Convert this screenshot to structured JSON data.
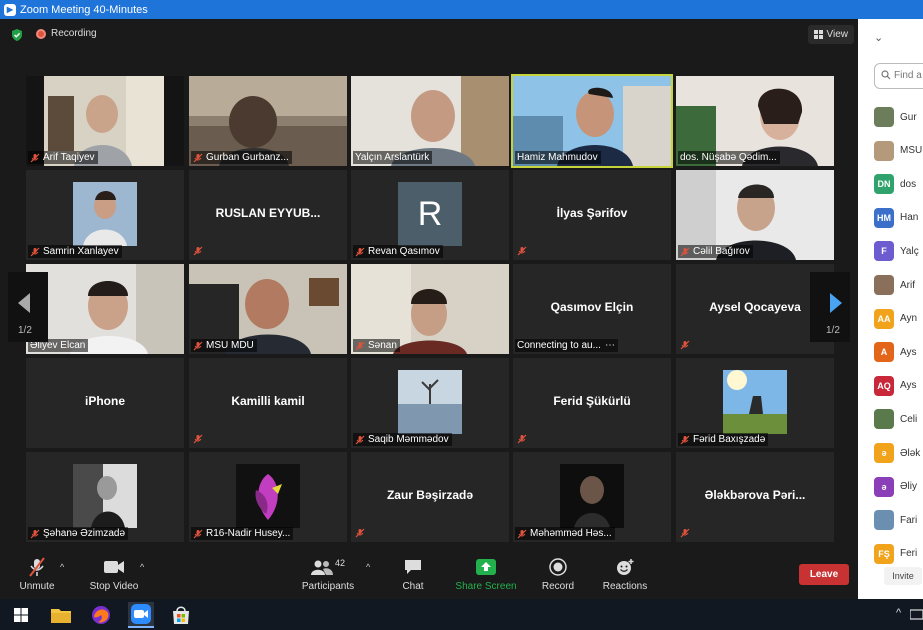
{
  "window": {
    "title": "Zoom Meeting 40-Minutes"
  },
  "topbar": {
    "recording_label": "Recording",
    "view_label": "View"
  },
  "tiles": [
    {
      "name": "Arif Taqiyev",
      "type": "video"
    },
    {
      "name": "Gurban Gurbanz...",
      "type": "video"
    },
    {
      "name": "Yalçın Arslantürk",
      "type": "video"
    },
    {
      "name": "Hamiz Mahmudov",
      "type": "video",
      "active": true
    },
    {
      "name": "dos. Nüşabə Qədim...",
      "type": "video"
    },
    {
      "name": "Samrin Xanlayev",
      "type": "picture"
    },
    {
      "name": "RUSLAN EYYUB...",
      "type": "name"
    },
    {
      "name": "Revan Qasımov",
      "type": "initial",
      "initial": "R"
    },
    {
      "name": "İlyas Şərifov",
      "type": "name"
    },
    {
      "name": "Cəlil Bağırov",
      "type": "video"
    },
    {
      "name": "Əliyev Elcan",
      "type": "video"
    },
    {
      "name": "MSU MDU",
      "type": "video"
    },
    {
      "name": "Sənan",
      "type": "video"
    },
    {
      "name": "Qasımov Elçin",
      "type": "name",
      "status": "Connecting to au..."
    },
    {
      "name": "Aysel Qocayeva",
      "type": "name"
    },
    {
      "name": "iPhone",
      "type": "name"
    },
    {
      "name": "Kamilli kamil",
      "type": "name"
    },
    {
      "name": "Saqib Məmmədov",
      "type": "picture"
    },
    {
      "name": "Ferid Şükürlü",
      "type": "name"
    },
    {
      "name": "Fərid Baxışzadə",
      "type": "picture"
    },
    {
      "name": "Şəhanə Əzimzadə",
      "type": "picture"
    },
    {
      "name": "R16-Nadir Husey...",
      "type": "picture"
    },
    {
      "name": "Zaur Bəşirzadə",
      "type": "name"
    },
    {
      "name": "Məhəmməd Həs...",
      "type": "picture"
    },
    {
      "name": "Ələkbərova Pəri...",
      "type": "name"
    }
  ],
  "paging": {
    "left": "1/2",
    "right": "1/2"
  },
  "toolbar": {
    "unmute": "Unmute",
    "stop_video": "Stop Video",
    "participants": "Participants",
    "participants_count": "42",
    "chat": "Chat",
    "share_screen": "Share Screen",
    "record": "Record",
    "reactions": "Reactions",
    "leave": "Leave"
  },
  "panel": {
    "find_placeholder": "Find a",
    "invite": "Invite",
    "participants": [
      {
        "text": "Gur",
        "avatar": "photo",
        "color": "#6b7d5a"
      },
      {
        "text": "MSU",
        "avatar": "photo",
        "color": "#b49a7a"
      },
      {
        "text": "dos",
        "avatar": "DN",
        "color": "#2fa36b"
      },
      {
        "text": "Han",
        "avatar": "HM",
        "color": "#3b6fc9"
      },
      {
        "text": "Yalç",
        "avatar": "F",
        "color": "#6d5bd0"
      },
      {
        "text": "Arif",
        "avatar": "photo",
        "color": "#8a6f5b"
      },
      {
        "text": "Ayn",
        "avatar": "AA",
        "color": "#f0a31b"
      },
      {
        "text": "Ays",
        "avatar": "A",
        "color": "#e2651a"
      },
      {
        "text": "Ays",
        "avatar": "AQ",
        "color": "#c8283a"
      },
      {
        "text": "Celi",
        "avatar": "photo",
        "color": "#5a7a4c"
      },
      {
        "text": "Ələk",
        "avatar": "ə",
        "color": "#f0a31b"
      },
      {
        "text": "Əliy",
        "avatar": "ə",
        "color": "#8a3fb8"
      },
      {
        "text": "Fari",
        "avatar": "photo",
        "color": "#6b8fb0"
      },
      {
        "text": "Feri",
        "avatar": "FŞ",
        "color": "#f0a31b"
      }
    ]
  },
  "colors": {
    "active_border": "#c7d33b",
    "leave": "#c83232",
    "share": "#22b14c",
    "titlebar": "#1e74d9"
  }
}
